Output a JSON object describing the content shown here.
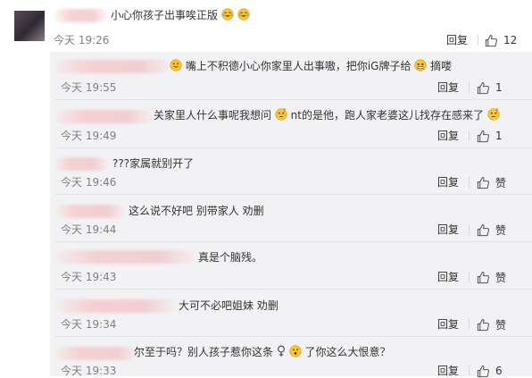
{
  "top_comment": {
    "text": "小心你孩子出事唉正版",
    "time": "今天 19:26",
    "reply_label": "回复",
    "like_count": "12"
  },
  "replies": [
    {
      "segments": [
        "嘴上不积德小心你家里人出事嗷，把你iG牌子给",
        "摘喽"
      ],
      "time": "今天 19:55",
      "reply_label": "回复",
      "like_label": "1"
    },
    {
      "segments": [
        "关家里人什么事呢我想问",
        "nt的是他，跑人家老婆这儿找存在感来了"
      ],
      "time": "今天 19:49",
      "reply_label": "回复",
      "like_label": "1"
    },
    {
      "segments": [
        "???家属就别开了"
      ],
      "time": "今天 19:46",
      "reply_label": "回复",
      "like_label": "赞"
    },
    {
      "segments": [
        "这么说不好吧 别带家人 劝删"
      ],
      "time": "今天 19:44",
      "reply_label": "回复",
      "like_label": "赞"
    },
    {
      "segments": [
        "真是个脑残。"
      ],
      "time": "今天 19:43",
      "reply_label": "回复",
      "like_label": "赞"
    },
    {
      "segments": [
        "大可不必吧姐妹 劝删"
      ],
      "time": "今天 19:34",
      "reply_label": "回复",
      "like_label": "赞"
    },
    {
      "segments": [
        "尔至于吗？别人孩子惹你这条",
        "了你这么大恨意？"
      ],
      "time": "今天 19:33",
      "reply_label": "回复",
      "like_label": "6"
    }
  ],
  "icons": {
    "like": "thumbs-up-icon",
    "tongue_emoji": "tongue-out-emoji-icon",
    "smile_emoji": "squint-smile-emoji-icon",
    "thinking_emoji": "thinking-face-emoji-icon",
    "female": "female-symbol-icon"
  },
  "colors": {
    "reply_panel_bg": "#f2f2f5",
    "meta_text": "#808080",
    "body_text": "#333333",
    "emoji_yellow": "#f8c630"
  }
}
